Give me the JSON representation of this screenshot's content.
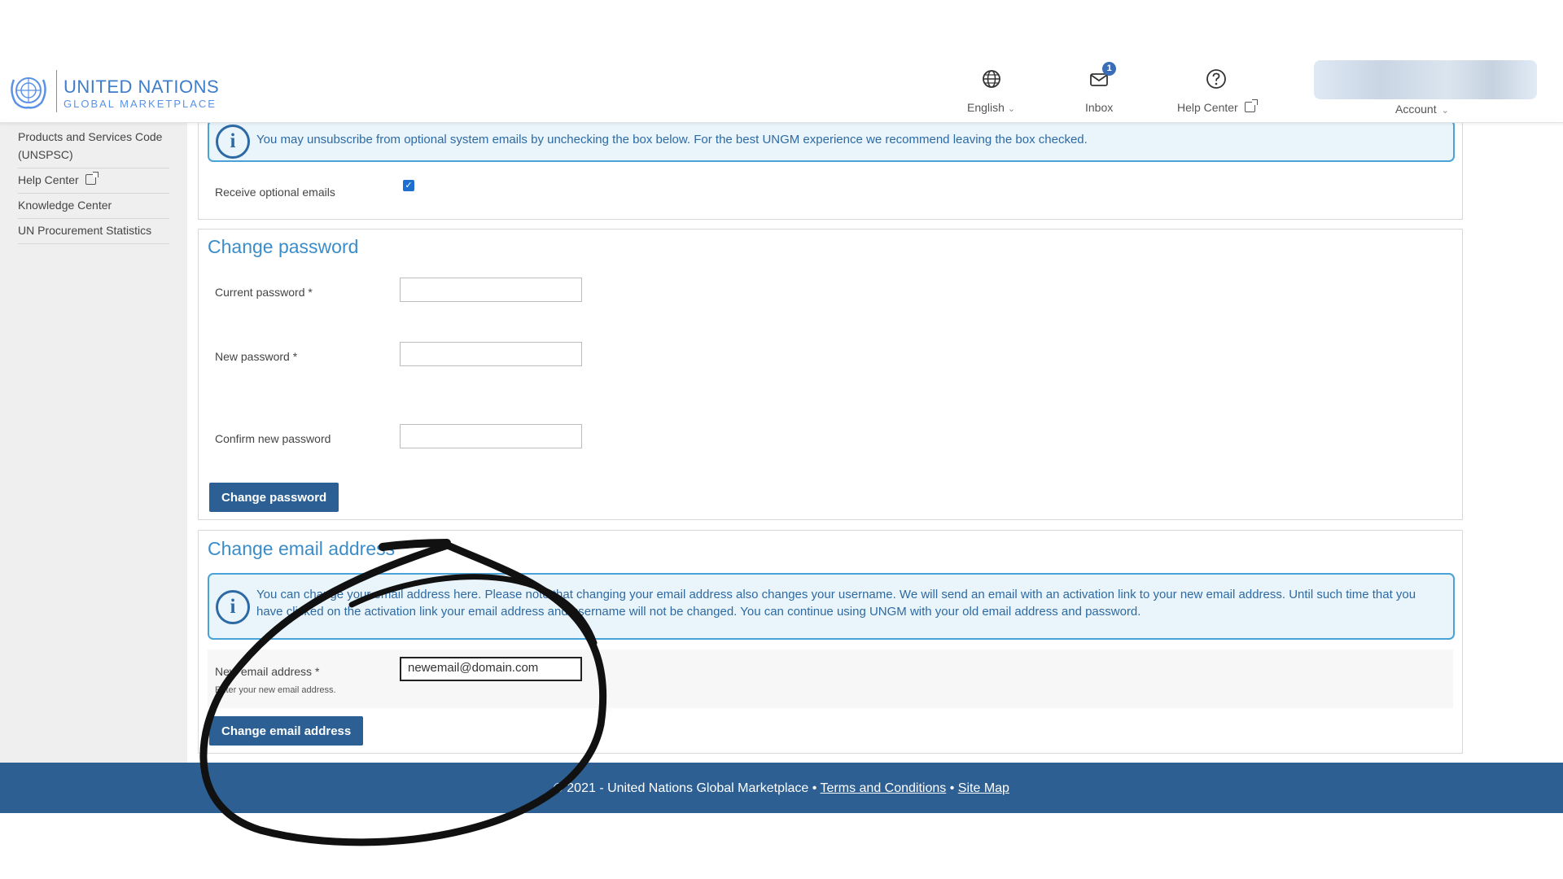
{
  "header": {
    "logo_line1": "UNITED NATIONS",
    "logo_line2": "GLOBAL MARKETPLACE",
    "language": "English",
    "inbox": "Inbox",
    "inbox_badge": "1",
    "help_center": "Help Center",
    "account": "Account"
  },
  "sidebar": {
    "items": [
      {
        "label": "Products and Services Code (UNSPSC)"
      },
      {
        "label": "Help Center"
      },
      {
        "label": "Knowledge Center"
      },
      {
        "label": "UN Procurement Statistics"
      }
    ]
  },
  "emails_section": {
    "info_text": "You may unsubscribe from optional system emails by unchecking the box below. For the best UNGM experience we recommend leaving the box checked.",
    "receive_label": "Receive optional emails",
    "receive_checked": true
  },
  "password_section": {
    "title": "Change password",
    "current_label": "Current password *",
    "new_label": "New password *",
    "confirm_label": "Confirm new password",
    "button": "Change password"
  },
  "email_section": {
    "title": "Change email address",
    "info_text": "You can change your email address here. Please note that changing your email address also changes your username. We will send an email with an activation link to your new email address. Until such time that you have clicked on the activation link your email address and username will not be changed. You can continue using UNGM with your old email address and password.",
    "new_label": "New email address *",
    "new_hint": "Enter your new email address.",
    "new_value": "newemail@domain.com",
    "button": "Change email address"
  },
  "footer": {
    "copyright": "© 2021 - United Nations Global Marketplace •",
    "terms": "Terms and Conditions",
    "sep": "•",
    "sitemap": "Site Map"
  },
  "colors": {
    "primary": "#2c5f93",
    "accent": "#3a8dc9",
    "info_bg": "#eaf5fb"
  }
}
